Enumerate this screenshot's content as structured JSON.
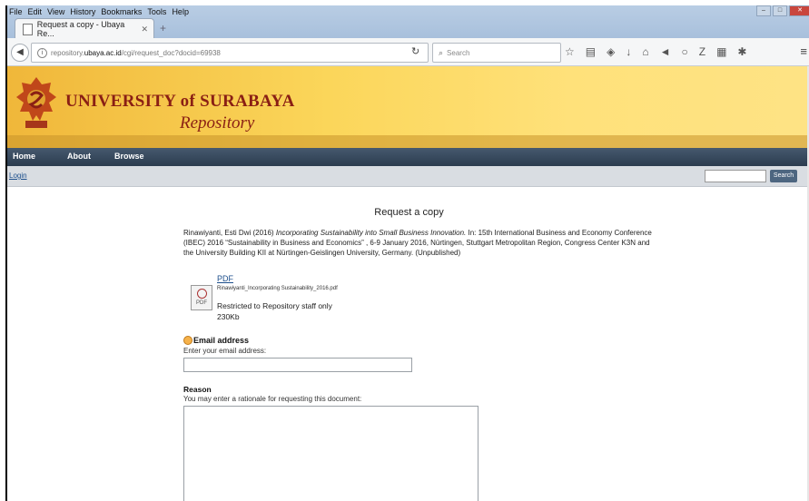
{
  "browser": {
    "menu": [
      "File",
      "Edit",
      "View",
      "History",
      "Bookmarks",
      "Tools",
      "Help"
    ],
    "tab_title": "Request a copy - Ubaya Re...",
    "new_tab": "+",
    "url_prefix": "repository.",
    "url_host": "ubaya.ac.id",
    "url_path": "/cgi/request_doc?docid=69938",
    "search_placeholder": "Search"
  },
  "site": {
    "brand_line1": "UNIVERSITY of SURABAYA",
    "brand_line2": "Repository",
    "nav": [
      "Home",
      "About",
      "Browse"
    ],
    "login": "Login",
    "search_button": "Search"
  },
  "page": {
    "heading": "Request a copy",
    "citation_plain1": "Rinawiyanti, Esti Dwi (2016) ",
    "citation_title": "Incorporating Sustainability into Small Business Innovation.",
    "citation_plain2": " In: 15th International Business and Economy Conference (IBEC) 2016 “Sustainability in Business and Economics” , 6-9 January 2016, Nürtingen, Stuttgart Metropolitan Region, Congress Center K3N and the University Building KII at Nürtingen-Geislingen University, Germany. (Unpublished)",
    "doc": {
      "type": "PDF",
      "filename": "Rinawiyanti_Incorporating Sustainability_2016.pdf",
      "restriction": "Restricted to Repository staff only",
      "size": "230Kb",
      "icon_label": "PDF"
    },
    "email_label": "Email address",
    "email_help": "Enter your email address:",
    "reason_label": "Reason",
    "reason_help": "You may enter a rationale for requesting this document:"
  }
}
